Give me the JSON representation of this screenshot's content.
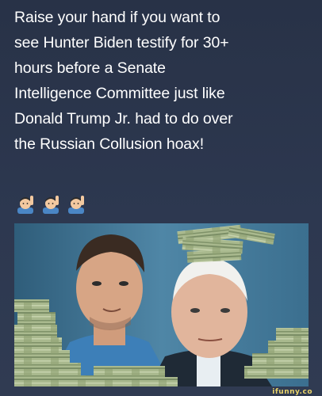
{
  "caption": {
    "lines": [
      "Raise your hand if you want to",
      "see Hunter Biden testify for 30+",
      "hours before a Senate",
      "Intelligence Committee just like",
      "Donald Trump Jr. had to do over",
      "the Russian Collusion hoax!"
    ]
  },
  "emojis": [
    "person-raising-hand-icon",
    "person-raising-hand-icon",
    "person-raising-hand-icon"
  ],
  "watermark": "ifunny.co",
  "colors": {
    "background": "#2a3346",
    "text": "#ffffff",
    "photo_background": "#3f6e8c",
    "money_green": "#8da67a"
  }
}
